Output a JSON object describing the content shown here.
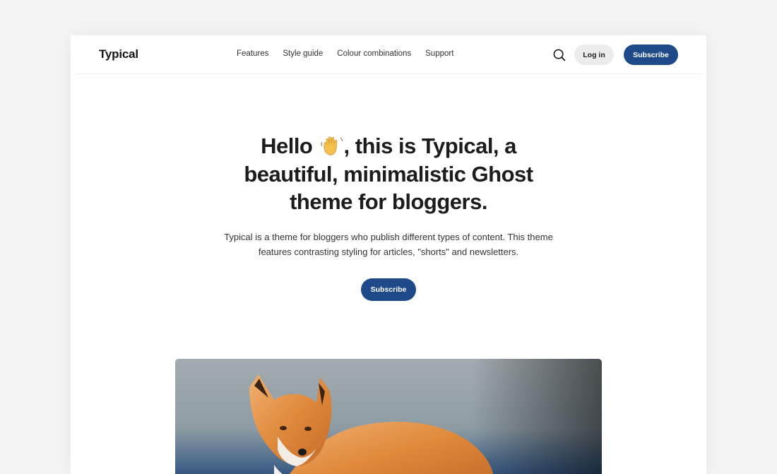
{
  "header": {
    "logo": "Typical",
    "nav": [
      "Features",
      "Style guide",
      "Colour combinations",
      "Support"
    ],
    "search_icon": "search-icon",
    "login_label": "Log in",
    "subscribe_label": "Subscribe"
  },
  "hero": {
    "title_lines": [
      [
        "Hello ",
        "waving-hand-emoji",
        ", this is Typical, a"
      ],
      "beautiful, minimalistic Ghost",
      "theme for bloggers."
    ],
    "title_part1": "Hello",
    "title_part2": ", this is Typical, a",
    "title_line2": "beautiful, minimalistic Ghost",
    "title_line3": "theme for bloggers.",
    "description_line1": "Typical is a theme for bloggers who publish different types of content. This theme",
    "description_line2": "features contrasting styling for articles, \"shorts\" and newsletters.",
    "subscribe_label": "Subscribe"
  },
  "feature_image": {
    "subject": "red fox"
  },
  "colors": {
    "accent": "#1f4a8a",
    "page_bg": "#f4f4f4",
    "card_bg": "#ffffff",
    "login_bg": "#ececec"
  }
}
